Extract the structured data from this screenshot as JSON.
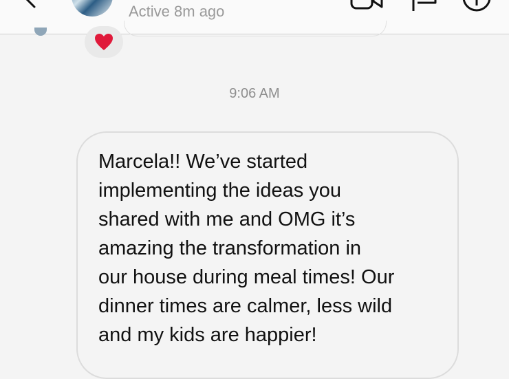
{
  "header": {
    "status": "Active 8m ago",
    "icons": {
      "back": "chevron-left-icon",
      "video": "video-camera-icon",
      "flag": "flag-icon",
      "info": "info-icon"
    }
  },
  "thread": {
    "reaction": "heart",
    "timestamp": "9:06 AM",
    "message": "Marcela!! We’ve started\nimplementing the ideas you\nshared with me and OMG it’s\namazing the transformation in\nour house during meal times! Our\ndinner times are calmer, less wild\nand my kids are happier!"
  },
  "colors": {
    "background": "#f4f4f4",
    "header_bg": "#fafafa",
    "heart": "#e0193a",
    "muted_text": "#8e8e8e"
  }
}
